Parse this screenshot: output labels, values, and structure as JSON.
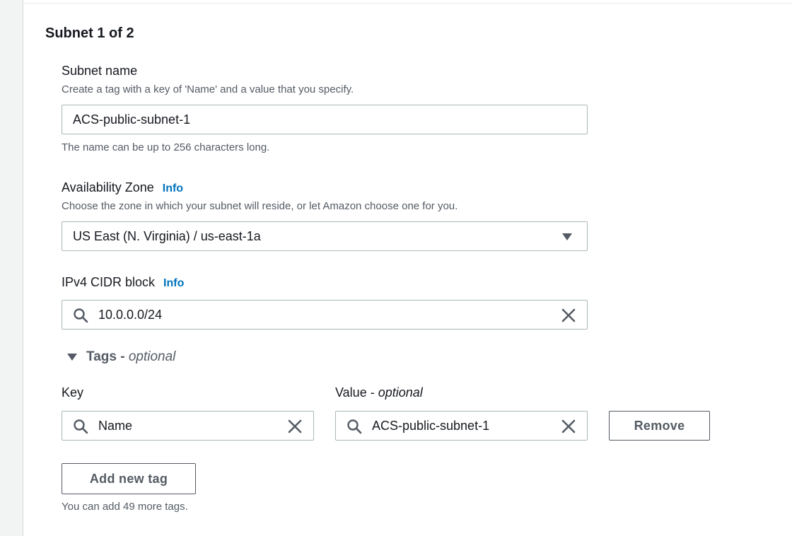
{
  "subnet_heading": "Subnet 1 of 2",
  "subnet_name": {
    "label": "Subnet name",
    "description": "Create a tag with a key of 'Name' and a value that you specify.",
    "value": "ACS-public-subnet-1",
    "hint": "The name can be up to 256 characters long."
  },
  "availability_zone": {
    "label": "Availability Zone",
    "info": "Info",
    "description": "Choose the zone in which your subnet will reside, or let Amazon choose one for you.",
    "value": "US East (N. Virginia) / us-east-1a"
  },
  "ipv4_cidr": {
    "label": "IPv4 CIDR block",
    "info": "Info",
    "value": "10.0.0.0/24"
  },
  "tags": {
    "toggle_label": "Tags - ",
    "toggle_optional": "optional",
    "key_header": "Key",
    "value_header": "Value - ",
    "value_header_optional": "optional",
    "rows": [
      {
        "key": "Name",
        "value": "ACS-public-subnet-1",
        "remove_label": "Remove"
      }
    ],
    "add_button": "Add new tag",
    "remaining_hint": "You can add 49 more tags."
  },
  "icons": {
    "search": "search-icon",
    "clear": "close-icon",
    "dropdown": "caret-down-icon",
    "expand": "caret-down-icon"
  },
  "colors": {
    "link": "#0073bb",
    "border": "#aab7b8",
    "text": "#16191f",
    "muted": "#545b64"
  }
}
